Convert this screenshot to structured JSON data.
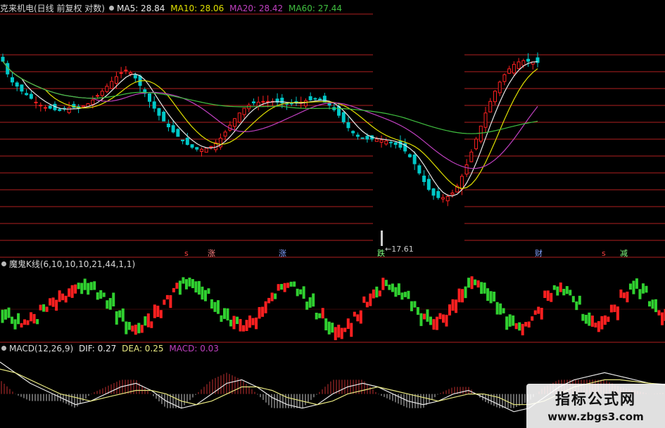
{
  "main_header": {
    "title": "克来机电(日线 前复权 对数)",
    "ma5": "MA5: 28.84",
    "ma10": "MA10: 28.06",
    "ma20": "MA20: 28.42",
    "ma60": "MA60: 27.44"
  },
  "annotations": {
    "low_price": "17.61",
    "markers": [
      "s",
      "涨",
      "涨",
      "跌",
      "财",
      "s",
      "减"
    ]
  },
  "indicator_header": "魔鬼K线(6,10,10,10,21,44,1,1)",
  "macd_header": {
    "title": "MACD(12,26,9)",
    "dif": "DIF: 0.27",
    "dea": "DEA: 0.25",
    "macd": "MACD: 0.03"
  },
  "watermark": {
    "title": "指标公式网",
    "url": "www.zbgs3.com"
  },
  "colors": {
    "up": "#ff2020",
    "down": "#00c8c8",
    "ind_up": "#ff2020",
    "ind_down": "#30d030",
    "ma5": "#e8e8e8",
    "ma10": "#e0e000",
    "ma20": "#c040c0",
    "ma60": "#40c040",
    "dif": "#e8e8e8",
    "dea": "#e8e880",
    "panel_line": "#b02020",
    "text": "#d8d8d8"
  },
  "chart_data": [
    {
      "type": "candlestick",
      "title": "克来机电(日线 前复权 对数)",
      "y_scale": "log",
      "ylim": [
        17,
        36
      ],
      "low_marker": 17.61,
      "close": [
        34.0,
        32.0,
        30.8,
        30.2,
        29.5,
        29.0,
        28.5,
        28.0,
        27.6,
        27.3,
        27.2,
        27.0,
        26.9,
        27.1,
        27.3,
        27.3,
        27.2,
        27.5,
        27.8,
        28.3,
        28.9,
        29.5,
        30.2,
        30.9,
        31.6,
        32.2,
        32.6,
        32.2,
        31.4,
        30.3,
        29.2,
        28.1,
        27.2,
        26.3,
        25.6,
        24.9,
        24.3,
        23.8,
        23.3,
        22.9,
        22.6,
        22.4,
        22.4,
        22.5,
        22.7,
        23.1,
        23.6,
        24.3,
        25.1,
        25.9,
        26.6,
        27.2,
        27.6,
        27.9,
        28.0,
        28.1,
        28.1,
        28.1,
        28.0,
        27.9,
        27.8,
        27.8,
        27.9,
        28.0,
        28.2,
        28.3,
        28.4,
        28.3,
        28.0,
        27.6,
        27.0,
        26.3,
        25.5,
        24.8,
        24.2,
        23.8,
        23.6,
        23.5,
        23.5,
        23.5,
        23.4,
        23.3,
        23.1,
        22.9,
        22.6,
        22.2,
        21.6,
        20.9,
        20.0,
        19.2,
        18.5,
        18.0,
        17.8,
        17.8,
        17.9,
        18.2,
        18.8,
        19.7,
        20.8,
        22.1,
        23.5,
        25.0,
        26.6,
        28.1,
        29.5,
        30.8,
        31.9,
        32.8,
        33.5,
        33.9,
        34.1,
        34.0,
        33.9,
        33.8
      ]
    },
    {
      "type": "bar",
      "title": "魔鬼K线(6,10,10,10,21,44,1,1)",
      "values": [
        -0.3,
        -0.5,
        -0.6,
        -0.4,
        -0.1,
        0.2,
        0.4,
        0.6,
        0.8,
        0.7,
        0.5,
        0.2,
        -0.3,
        -0.7,
        -0.8,
        -0.6,
        -0.2,
        0.3,
        0.7,
        0.9,
        0.8,
        0.5,
        0.1,
        -0.3,
        -0.6,
        -0.7,
        -0.5,
        -0.1,
        0.4,
        0.7,
        0.8,
        0.6,
        0.2,
        -0.3,
        -0.7,
        -0.9,
        -0.7,
        -0.3,
        0.2,
        0.6,
        0.8,
        0.7,
        0.4,
        0.0,
        -0.4,
        -0.6,
        -0.4,
        0.0,
        0.5,
        0.9,
        0.8,
        0.4,
        -0.1,
        -0.5,
        -0.7,
        -0.5,
        -0.1,
        0.4,
        0.7,
        0.6,
        0.2,
        -0.3,
        -0.6,
        -0.5,
        -0.1,
        0.4,
        0.8,
        0.6,
        0.2,
        -0.3
      ]
    },
    {
      "type": "line",
      "title": "MACD(12,26,9)",
      "series": [
        {
          "name": "DIF",
          "values": [
            0.9,
            0.6,
            0.3,
            0.1,
            -0.1,
            -0.3,
            -0.2,
            0.0,
            0.2,
            0.3,
            0.1,
            -0.2,
            -0.4,
            -0.3,
            0.0,
            0.3,
            0.4,
            0.2,
            -0.1,
            -0.3,
            -0.4,
            -0.3,
            0.0,
            0.2,
            0.3,
            0.2,
            0.0,
            -0.2,
            -0.3,
            -0.2,
            0.0,
            0.1,
            -0.1,
            -0.3,
            -0.5,
            -0.4,
            -0.1,
            0.2,
            0.4,
            0.5,
            0.6,
            0.5,
            0.4,
            0.3,
            0.27
          ]
        },
        {
          "name": "DEA",
          "values": [
            0.7,
            0.6,
            0.4,
            0.2,
            0.0,
            -0.1,
            -0.2,
            -0.1,
            0.0,
            0.1,
            0.1,
            0.0,
            -0.2,
            -0.3,
            -0.2,
            0.0,
            0.2,
            0.2,
            0.1,
            -0.1,
            -0.2,
            -0.3,
            -0.2,
            0.0,
            0.1,
            0.2,
            0.1,
            0.0,
            -0.1,
            -0.2,
            -0.1,
            0.0,
            0.0,
            -0.1,
            -0.3,
            -0.3,
            -0.2,
            0.0,
            0.2,
            0.3,
            0.4,
            0.4,
            0.35,
            0.3,
            0.25
          ]
        }
      ],
      "ylim": [
        -0.8,
        1.1
      ]
    }
  ]
}
